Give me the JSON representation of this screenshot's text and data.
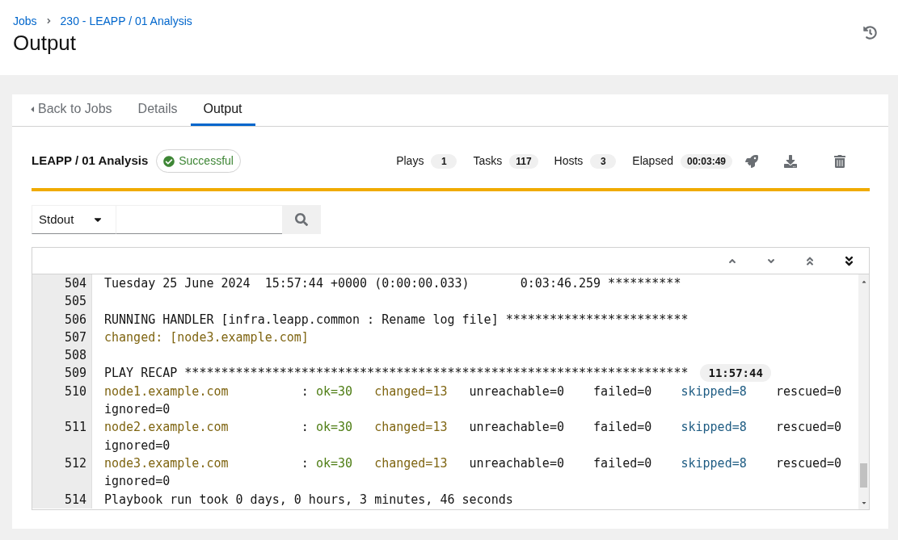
{
  "breadcrumb": [
    {
      "label": "Jobs"
    },
    {
      "label": "230 - LEAPP / 01 Analysis"
    }
  ],
  "page_title": "Output",
  "tabs": [
    {
      "label": "Back to Jobs",
      "kind": "back",
      "selected": false
    },
    {
      "label": "Details",
      "kind": "tab",
      "selected": false
    },
    {
      "label": "Output",
      "kind": "tab",
      "selected": true
    }
  ],
  "job": {
    "name": "LEAPP / 01 Analysis",
    "status": {
      "label": "Successful",
      "kind": "success"
    }
  },
  "stats": [
    {
      "label": "Plays",
      "value": "1"
    },
    {
      "label": "Tasks",
      "value": "117"
    },
    {
      "label": "Hosts",
      "value": "3"
    },
    {
      "label": "Elapsed",
      "value": "00:03:49"
    }
  ],
  "filter": {
    "value": "Stdout"
  },
  "output": {
    "nav": [
      {
        "kind": "up",
        "active": false
      },
      {
        "kind": "down",
        "active": false
      },
      {
        "kind": "top",
        "active": false
      },
      {
        "kind": "bottom",
        "active": true
      }
    ],
    "lines": [
      {
        "number": "504",
        "segments": [
          {
            "text": "Tuesday 25 June 2024  15:57:44 +0000 (0:00:00.033)       0:03:46.259 **********"
          }
        ]
      },
      {
        "number": "505"
      },
      {
        "number": "506",
        "segments": [
          {
            "text": "RUNNING HANDLER [infra.leapp.common : Rename log file] *************************"
          }
        ]
      },
      {
        "number": "507",
        "segments": [
          {
            "text": "changed: [node3.example.com]",
            "color": "#7f6512"
          }
        ]
      },
      {
        "number": "508"
      },
      {
        "number": "509",
        "segments": [
          {
            "text": "PLAY RECAP *********************************************************************"
          }
        ],
        "timestamp": "11:57:44"
      },
      {
        "number": "510",
        "segments": [
          {
            "text": "node1.example.com",
            "color": "#7f6512"
          },
          {
            "text": "          :"
          },
          {
            "text": " ok=30",
            "color": "#4e7d14"
          },
          {
            "text": "   changed=13",
            "color": "#7f6512"
          },
          {
            "text": "   unreachable=0"
          },
          {
            "text": "    failed=0"
          },
          {
            "text": "    skipped=8",
            "color": "#1d5b82"
          },
          {
            "text": "    rescued=0"
          },
          {
            "text": "    ignored=0"
          }
        ]
      },
      {
        "number": "511",
        "segments": [
          {
            "text": "node2.example.com",
            "color": "#7f6512"
          },
          {
            "text": "          :"
          },
          {
            "text": " ok=30",
            "color": "#4e7d14"
          },
          {
            "text": "   changed=13",
            "color": "#7f6512"
          },
          {
            "text": "   unreachable=0"
          },
          {
            "text": "    failed=0"
          },
          {
            "text": "    skipped=8",
            "color": "#1d5b82"
          },
          {
            "text": "    rescued=0"
          },
          {
            "text": "    ignored=0"
          }
        ]
      },
      {
        "number": "512",
        "segments": [
          {
            "text": "node3.example.com",
            "color": "#7f6512"
          },
          {
            "text": "          :"
          },
          {
            "text": " ok=30",
            "color": "#4e7d14"
          },
          {
            "text": "   changed=13",
            "color": "#7f6512"
          },
          {
            "text": "   unreachable=0"
          },
          {
            "text": "    failed=0"
          },
          {
            "text": "    skipped=8",
            "color": "#1d5b82"
          },
          {
            "text": "    rescued=0"
          },
          {
            "text": "    ignored=0"
          }
        ]
      },
      {
        "number": "514",
        "segments": [
          {
            "text": "Playbook run took 0 days, 0 hours, 3 minutes, 46 seconds"
          }
        ]
      }
    ]
  }
}
